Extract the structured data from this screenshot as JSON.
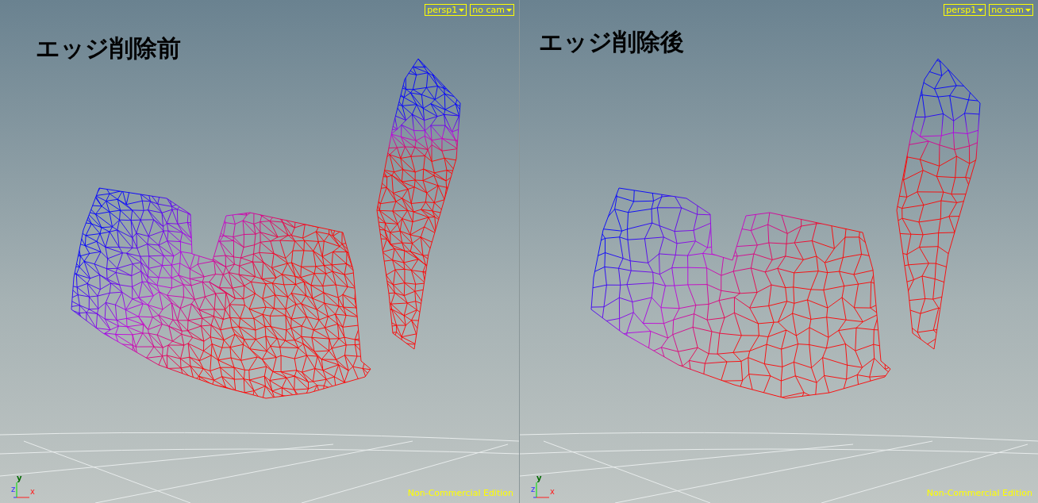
{
  "viewports": [
    {
      "title": "エッジ削除前",
      "camera_menu": "persp1",
      "lens_menu": "no cam",
      "axes": {
        "y": "y",
        "z": "z",
        "x": "x"
      },
      "edition": "Non-Commercial Edition"
    },
    {
      "title": "エッジ削除後",
      "camera_menu": "persp1",
      "lens_menu": "no cam",
      "axes": {
        "y": "y",
        "z": "z",
        "x": "x"
      },
      "edition": "Non-Commercial Edition"
    }
  ]
}
